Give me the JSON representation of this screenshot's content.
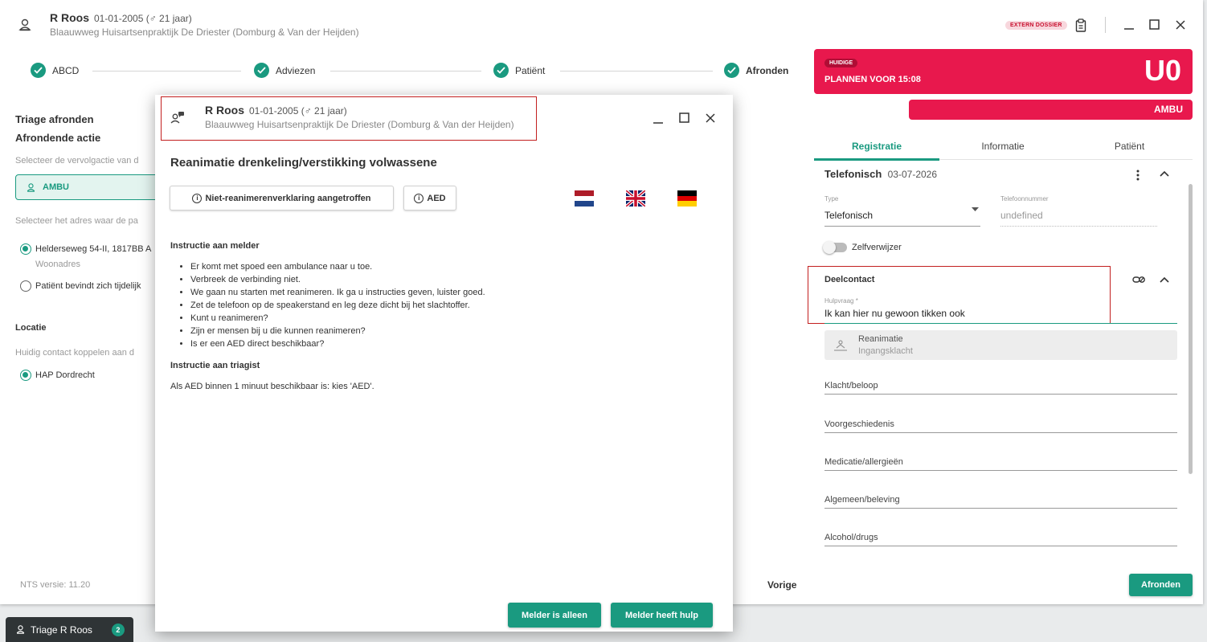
{
  "header": {
    "patient_name": "R Roos",
    "dob": "01-01-2005 (♂ 21 jaar)",
    "practice": "Blaauwweg Huisartsenpraktijk De Driester (Domburg & Van der Heijden)",
    "extern_badge": "EXTERN DOSSIER"
  },
  "stepper": [
    {
      "label": "ABCD"
    },
    {
      "label": "Adviezen"
    },
    {
      "label": "Patiënt"
    },
    {
      "label": "Afronden"
    }
  ],
  "left": {
    "title": "Triage afronden",
    "subtitle": "Afrondende actie",
    "followup_hint": "Selecteer de vervolgactie van d",
    "ambu_label": "AMBU",
    "address_hint": "Selecteer het adres waar de pa",
    "address_option": "Helderseweg 54-II, 1817BB A",
    "address_sub": "Woonadres",
    "temp_option": "Patiënt bevindt zich tijdelijk",
    "location_title": "Locatie",
    "location_hint": "Huidig contact koppelen aan d",
    "location_option": "HAP Dordrecht",
    "version": "NTS versie: 11.20"
  },
  "urgency": {
    "badge": "HUIDIGE",
    "plan": "PLANNEN VOOR 15:08",
    "code": "U0",
    "ambu": "AMBU"
  },
  "tabs": [
    "Registratie",
    "Informatie",
    "Patiënt"
  ],
  "registration": {
    "contact_type": "Telefonisch",
    "contact_date": "03-07-2026",
    "type_label": "Type",
    "type_value": "Telefonisch",
    "phone_label": "Telefoonnummer",
    "phone_value": "undefined",
    "self_referrer": "Zelfverwijzer",
    "deelcontact": "Deelcontact",
    "hulpvraag_label": "Hulpvraag *",
    "hulpvraag_value": "Ik kan hier nu gewoon tikken ook",
    "complaint_title": "Reanimatie",
    "complaint_sub": "Ingangsklacht",
    "fields": [
      "Klacht/beloop",
      "Voorgeschiedenis",
      "Medicatie/allergieën",
      "Algemeen/beleving",
      "Alcohol/drugs"
    ]
  },
  "footer": {
    "prev": "Vorige",
    "finish": "Afronden"
  },
  "dialog": {
    "title": "Reanimatie drenkeling/verstikking volwassene",
    "btn_dnr": "Niet-reanimerenverklaring aangetroffen",
    "btn_aed": "AED",
    "flags": [
      "Nederlands",
      "English",
      "Deutsch"
    ],
    "melder_title": "Instructie aan melder",
    "melder_items": [
      "Er komt met spoed een ambulance naar u toe.",
      "Verbreek de verbinding niet.",
      "We gaan nu starten met reanimeren. Ik ga u instructies geven, luister goed.",
      "Zet de telefoon op de speakerstand en leg deze dicht bij het slachtoffer.",
      "Kunt u reanimeren?",
      "Zijn er mensen bij u die kunnen reanimeren?",
      "Is er een AED direct beschikbaar?"
    ],
    "triagist_title": "Instructie aan triagist",
    "triagist_text": "Als AED binnen 1 minuut beschikbaar is: kies 'AED'.",
    "btn_alone": "Melder is alleen",
    "btn_help": "Melder heeft hulp"
  },
  "taskbar": {
    "label": "Triage R Roos",
    "count": "2"
  },
  "colors": {
    "accent": "#1a9a80",
    "urgent": "#e8184d"
  }
}
